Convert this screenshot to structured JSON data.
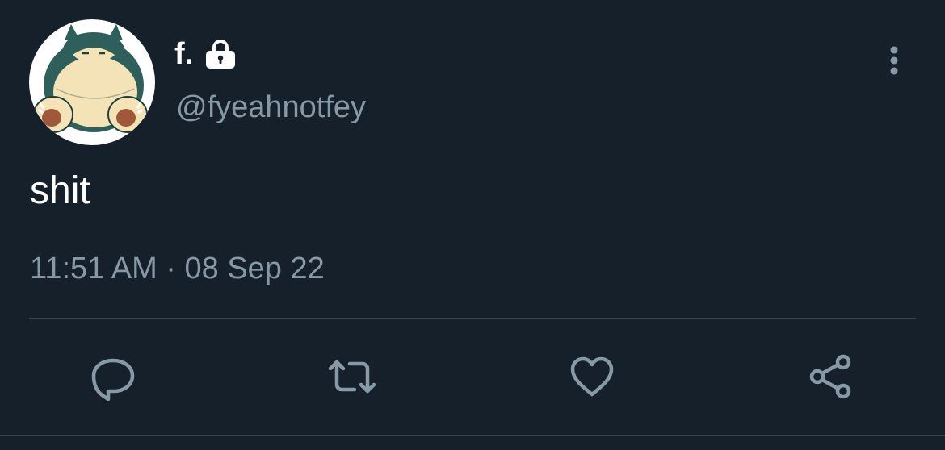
{
  "author": {
    "display_name": "f.",
    "handle": "@fyeahnotfey",
    "protected_icon": "lock-icon",
    "avatar_icon": "snorlax-avatar"
  },
  "tweet": {
    "text": "shit",
    "timestamp": "11:51 AM · 08 Sep 22"
  },
  "actions": [
    {
      "name": "reply",
      "icon": "reply-icon"
    },
    {
      "name": "retweet",
      "icon": "retweet-icon"
    },
    {
      "name": "like",
      "icon": "heart-icon"
    },
    {
      "name": "share",
      "icon": "share-icon"
    }
  ],
  "colors": {
    "background": "#15202b",
    "primary_text": "#ffffff",
    "secondary_text": "#8899a6",
    "divider": "#38444d"
  }
}
